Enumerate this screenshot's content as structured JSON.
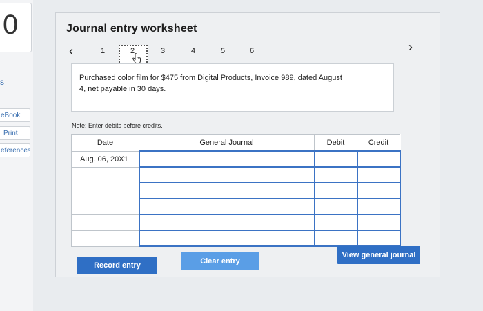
{
  "sidebar": {
    "score_digit": "0",
    "section_letter": "s",
    "links": [
      "eBook",
      "Print",
      "eferences"
    ]
  },
  "worksheet": {
    "title": "Journal entry worksheet",
    "prev_icon": "chevron-left-icon",
    "next_icon": "chevron-right-icon",
    "pages": [
      "1",
      "2",
      "3",
      "4",
      "5",
      "6"
    ],
    "current_page": "2"
  },
  "question": {
    "text_line1": "Purchased color film for $475 from Digital Products, Invoice 989, dated August",
    "text_line2": "4, net payable in 30 days."
  },
  "note": "Note: Enter debits before credits.",
  "table": {
    "headers": {
      "date": "Date",
      "journal": "General Journal",
      "debit": "Debit",
      "credit": "Credit"
    },
    "rows": [
      {
        "date": "Aug. 06, 20X1",
        "account": "",
        "debit": "",
        "credit": ""
      },
      {
        "date": "",
        "account": "",
        "debit": "",
        "credit": ""
      },
      {
        "date": "",
        "account": "",
        "debit": "",
        "credit": ""
      },
      {
        "date": "",
        "account": "",
        "debit": "",
        "credit": ""
      },
      {
        "date": "",
        "account": "",
        "debit": "",
        "credit": ""
      },
      {
        "date": "",
        "account": "",
        "debit": "",
        "credit": ""
      }
    ]
  },
  "buttons": {
    "record": "Record entry",
    "clear": "Clear entry",
    "view": "View general journal"
  },
  "colors": {
    "button_primary": "#2f6fc5",
    "button_clear": "#5a9ee6",
    "input_border": "#3b73c4",
    "link": "#3a6fb0"
  }
}
